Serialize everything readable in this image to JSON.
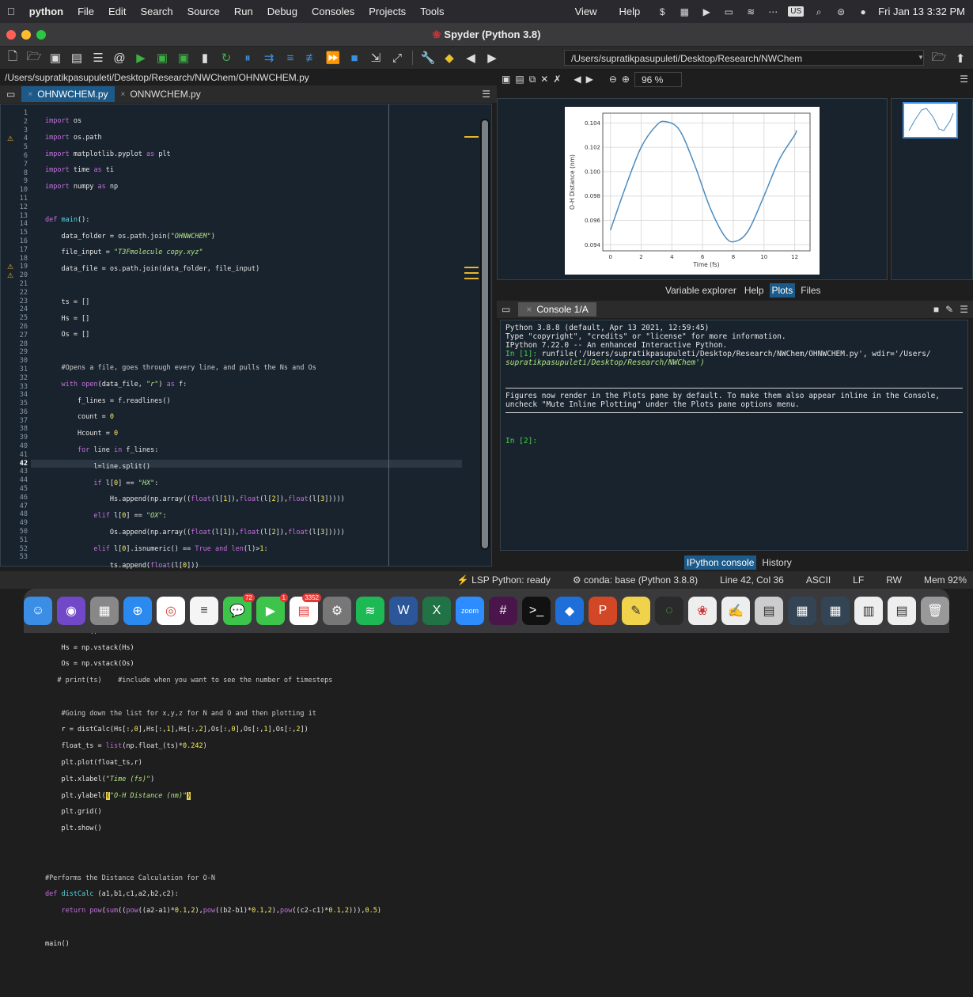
{
  "menubar": {
    "apple": "",
    "app": "python",
    "items": [
      "File",
      "Edit",
      "Search",
      "Source",
      "Run",
      "Debug",
      "Consoles",
      "Projects",
      "Tools"
    ],
    "right_items": [
      "View",
      "Help"
    ],
    "lang_badge": "US",
    "datetime": "Fri Jan 13  3:32 PM"
  },
  "window": {
    "title": "Spyder (Python 3.8)"
  },
  "toolbar": {
    "path": "/Users/supratikpasupuleti/Desktop/Research/NWChem"
  },
  "editor": {
    "file_path": "/Users/supratikpasupuleti/Desktop/Research/NWChem/OHNWCHEM.py",
    "tabs": [
      {
        "label": "OHNWCHEM.py",
        "active": true
      },
      {
        "label": "ONNWCHEM.py",
        "active": false
      }
    ],
    "line_numbers": [
      "1",
      "2",
      "3",
      "4",
      "5",
      "6",
      "7",
      "8",
      "9",
      "10",
      "11",
      "12",
      "13",
      "14",
      "15",
      "16",
      "17",
      "18",
      "19",
      "20",
      "21",
      "22",
      "23",
      "24",
      "25",
      "26",
      "27",
      "28",
      "29",
      "30",
      "31",
      "32",
      "33",
      "34",
      "35",
      "36",
      "37",
      "38",
      "39",
      "40",
      "41",
      "42",
      "43",
      "44",
      "45",
      "46",
      "47",
      "48",
      "49",
      "50",
      "51",
      "52",
      "53"
    ],
    "current_line": "42",
    "warning_lines": [
      "4",
      "19",
      "20"
    ]
  },
  "plots": {
    "zoom": "96 %",
    "pane_tabs": [
      "Variable explorer",
      "Help",
      "Plots",
      "Files"
    ],
    "active_tab": "Plots"
  },
  "chart_data": {
    "type": "line",
    "xlabel": "Time (fs)",
    "ylabel": "O-H Distance (nm)",
    "xlim": [
      -0.5,
      13
    ],
    "ylim": [
      0.0935,
      0.1048
    ],
    "xticks": [
      "0",
      "2",
      "4",
      "6",
      "8",
      "10",
      "12"
    ],
    "yticks": [
      "0.094",
      "0.096",
      "0.098",
      "0.100",
      "0.102",
      "0.104"
    ],
    "grid": true,
    "color": "#4c8cbf",
    "x": [
      0,
      1,
      2,
      3,
      3.6,
      4.5,
      5.5,
      6.5,
      7.5,
      8.2,
      9,
      10,
      11,
      12,
      12.1
    ],
    "y": [
      0.0952,
      0.0988,
      0.102,
      0.1038,
      0.1041,
      0.1034,
      0.1005,
      0.097,
      0.0946,
      0.0943,
      0.0952,
      0.098,
      0.101,
      0.103,
      0.1034
    ]
  },
  "console": {
    "tab": "Console 1/A",
    "lines": [
      "Python 3.8.8 (default, Apr 13 2021, 12:59:45)",
      "Type \"copyright\", \"credits\" or \"license\" for more information.",
      "",
      "IPython 7.22.0 -- An enhanced Interactive Python.",
      ""
    ],
    "prompt1": "In [1]:",
    "cmd1": " runfile('/Users/supratikpasupuleti/Desktop/Research/NWChem/OHNWCHEM.py', wdir='/Users/",
    "cmd1b": "supratikpasupuleti/Desktop/Research/NWChem')",
    "notice1": "Figures now render in the Plots pane by default. To make them also appear inline in the Console,",
    "notice2": "uncheck \"Mute Inline Plotting\" under the Plots pane options menu.",
    "prompt2": "In [2]:",
    "tabs": [
      "IPython console",
      "History"
    ]
  },
  "status": {
    "lsp": "LSP Python: ready",
    "conda": "conda: base (Python 3.8.8)",
    "position": "Line 42, Col 36",
    "encoding": "ASCII",
    "eol": "LF",
    "perm": "RW",
    "mem": "Mem 92%"
  },
  "dock": {
    "badges": {
      "messages": "72",
      "facetime": "1",
      "calendar": "3352"
    },
    "zoom_label": "zoom"
  }
}
